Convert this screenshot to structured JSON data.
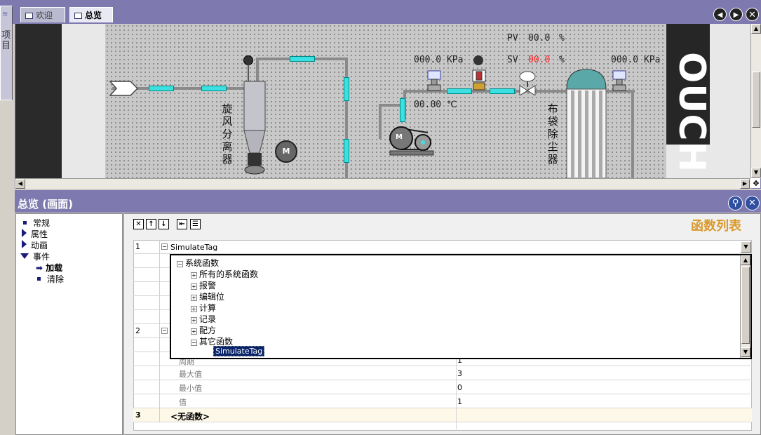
{
  "tabs": {
    "side_label": "项目",
    "welcome": "欢迎",
    "overview": "总览"
  },
  "diagram": {
    "pv_label": "PV",
    "pv_value": "00.0",
    "sv_label": "SV",
    "sv_value": "00.0",
    "percent": "%",
    "pressure_left": "000.0 KPa",
    "pressure_right": "000.0 KPa",
    "temperature": "00.00 ℃",
    "cyclone_label": "旋风分离器",
    "baghouse_label": "布袋除尘器",
    "motor_label": "M",
    "motor2_label": "M",
    "side_text": "OUCH"
  },
  "panel": {
    "title": "总览 (画面)",
    "function_list_title": "函数列表"
  },
  "tree": {
    "items": [
      {
        "label": "常规"
      },
      {
        "label": "属性"
      },
      {
        "label": "动画"
      },
      {
        "label": "事件"
      },
      {
        "label": "加载"
      },
      {
        "label": "清除"
      }
    ]
  },
  "grid": {
    "row1": {
      "number": "1",
      "function": "SimulateTag"
    },
    "row2": {
      "number": "2"
    },
    "row3": {
      "number": "3",
      "function": "<无函数>"
    },
    "params": [
      {
        "name": "周期",
        "value": "1"
      },
      {
        "name": "最大值",
        "value": "3"
      },
      {
        "name": "最小值",
        "value": "0"
      },
      {
        "name": "值",
        "value": "1"
      }
    ]
  },
  "dropdown": {
    "root": "系统函数",
    "children": [
      "所有的系统函数",
      "报警",
      "编辑位",
      "计算",
      "记录",
      "配方",
      "其它函数"
    ],
    "selected": "SimulateTag"
  },
  "colors": {
    "accent": "#7e7ab0",
    "orange": "#d99a2e",
    "sv_red": "#ff2020",
    "cyan": "#3ce0e0"
  }
}
